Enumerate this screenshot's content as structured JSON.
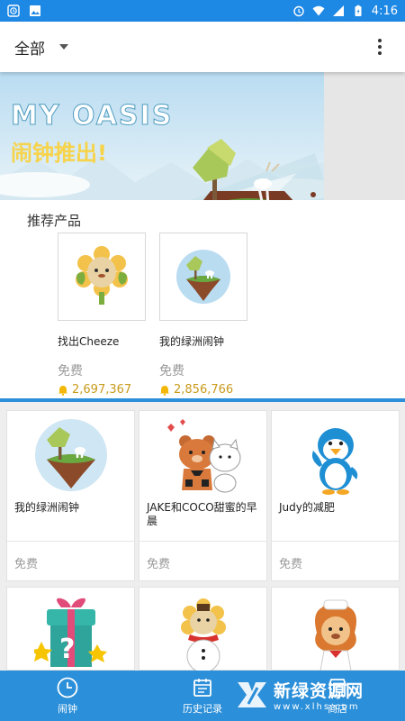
{
  "status_bar": {
    "time": "4:16"
  },
  "app_bar": {
    "filter_label": "全部"
  },
  "banner": {
    "title_en": "MY OASIS",
    "subtitle_cn": "闹钟推出!"
  },
  "recommended": {
    "title": "推荐产品",
    "items": [
      {
        "name": "找出Cheeze",
        "price": "免费",
        "count": "2,697,367",
        "icon": "flower-hamster-icon"
      },
      {
        "name": "我的绿洲闹钟",
        "price": "免费",
        "count": "2,856,766",
        "icon": "floating-island-icon"
      }
    ]
  },
  "grid": [
    {
      "name": "我的绿洲闹钟",
      "price": "免费",
      "icon": "floating-island-icon"
    },
    {
      "name": "JAKE和COCO甜蜜的早晨",
      "price": "免费",
      "icon": "bear-and-cat-icon"
    },
    {
      "name": "Judy的减肥",
      "price": "免费",
      "icon": "penguin-icon"
    },
    {
      "name": "",
      "price": "",
      "icon": "gift-box-icon"
    },
    {
      "name": "",
      "price": "",
      "icon": "snowman-hamster-icon"
    },
    {
      "name": "",
      "price": "",
      "icon": "chef-lion-icon"
    }
  ],
  "bottom_nav": [
    {
      "label": "闹钟",
      "icon": "clock-icon"
    },
    {
      "label": "历史记录",
      "icon": "calendar-icon"
    },
    {
      "label": "商店",
      "icon": "store-icon"
    }
  ],
  "watermark": {
    "title": "新绿资源网",
    "subtitle": "www.xlhs.com"
  },
  "colors": {
    "primary": "#2b8fd9",
    "status_bar": "#1e88e5",
    "price_gold": "#c89a1a",
    "muted": "#999999"
  }
}
